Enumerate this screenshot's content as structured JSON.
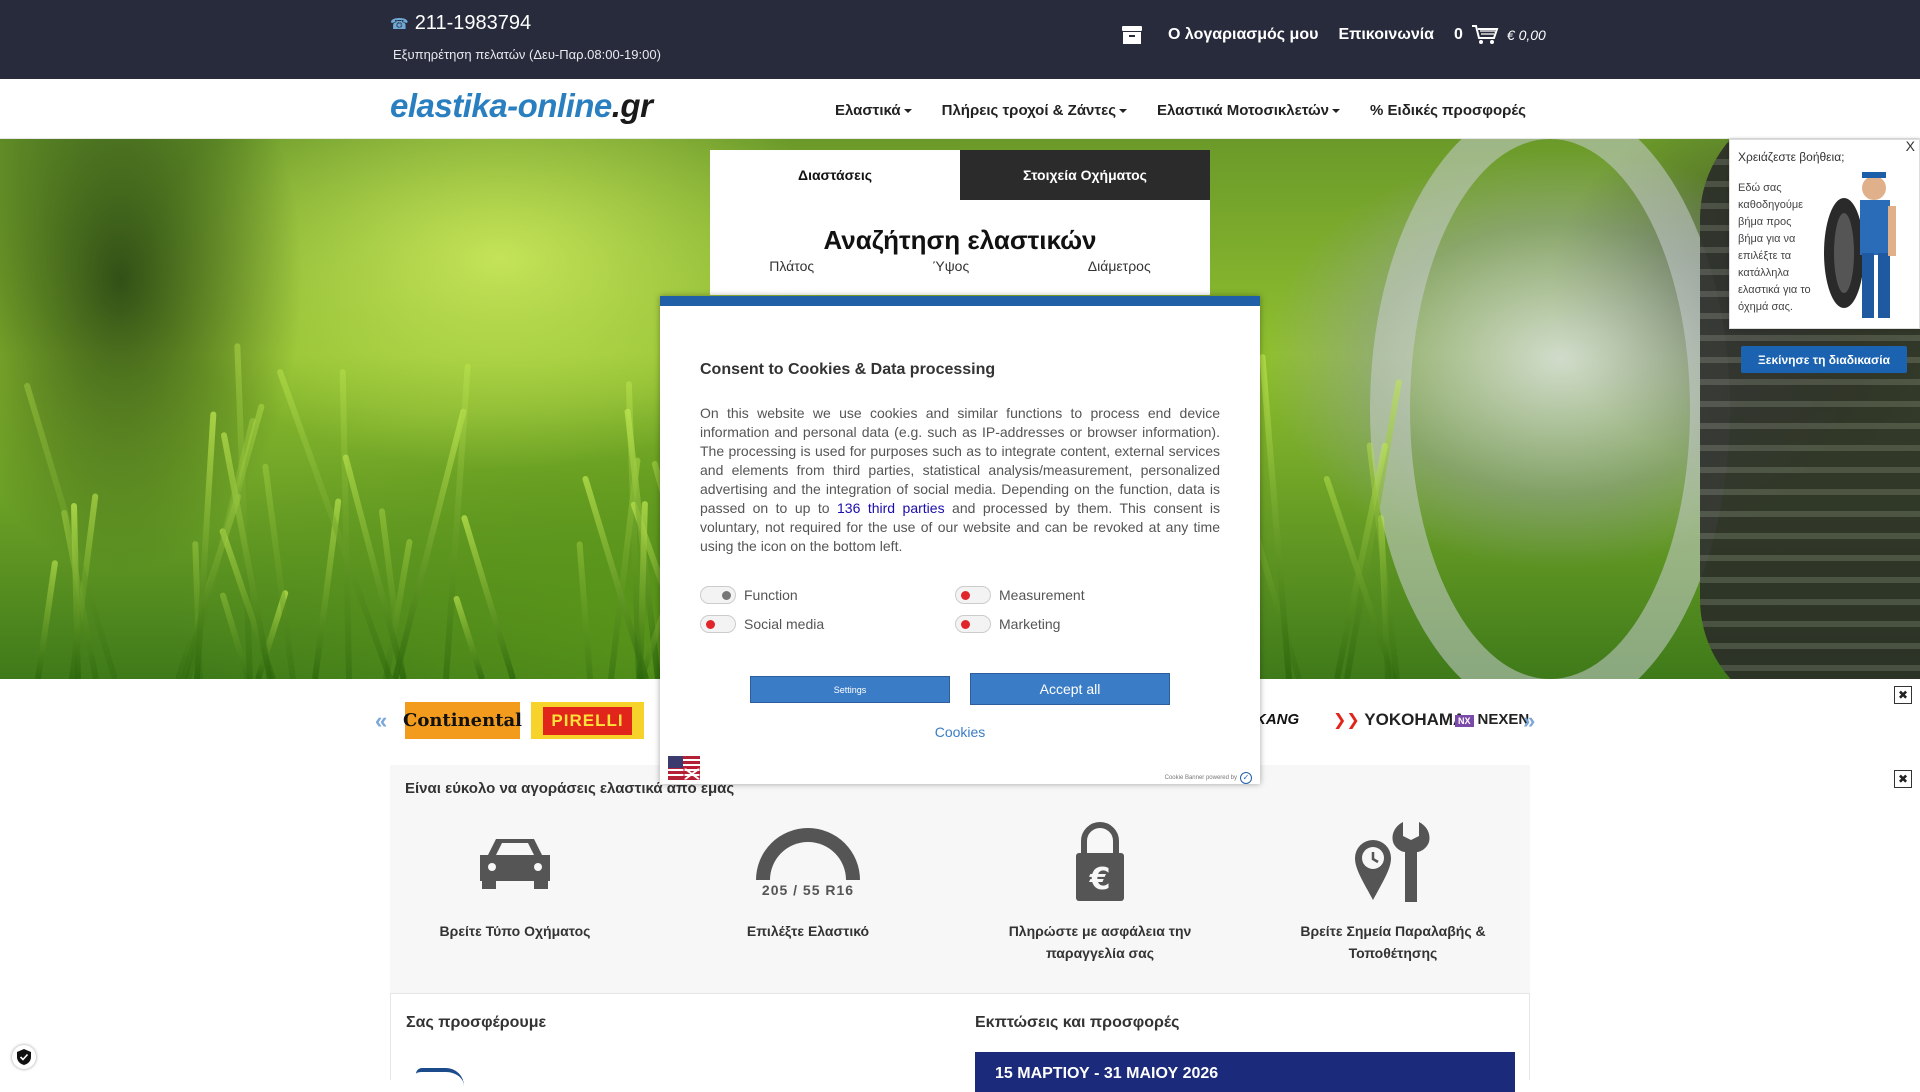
{
  "header": {
    "phone": "211-1983794",
    "hours": "Εξυπηρέτηση πελατών (Δευ-Παρ.08:00-19:00)",
    "account": "Ο λογαριασμός μου",
    "contact": "Επικοινωνία",
    "cart_count": "0",
    "cart_total": "€ 0,00"
  },
  "logo": {
    "part1": "elastika-online",
    "part2": ".gr"
  },
  "menu": [
    {
      "label": "Ελαστικά"
    },
    {
      "label": "Πλήρεις τροχοί & Ζάντες"
    },
    {
      "label": "Ελαστικά Μοτοσικλετών"
    },
    {
      "label": "% Ειδικές προσφορές"
    }
  ],
  "search": {
    "tab_dimensions": "Διαστάσεις",
    "tab_vehicle": "Στοιχεία Οχήματος",
    "title": "Αναζήτηση ελαστικών",
    "width_label": "Πλάτος",
    "height_label": "Ύψος",
    "diameter_label": "Διάμετρος"
  },
  "help": {
    "title": "Χρειάζεστε βοήθεια;",
    "body": "Εδώ σας καθοδηγούμε βήμα προς βήμα για να επιλέξτε τα κατάλληλα ελαστικά για το όχημά σας.",
    "close": "X",
    "button": "Ξεκίνησε τη διαδικασία"
  },
  "brands": {
    "continental": "Continental",
    "pirelli": "PIRELLI",
    "kang": "KANG",
    "yokohama": "YOKOHAMA",
    "nexen": "NEXEN"
  },
  "easy": {
    "title": "Είναι εύκολο να αγοράσεις ελαστικά από εμάς",
    "tire_size": "205 / 55 R16",
    "steps": [
      {
        "label": "Βρείτε Τύπο Οχήματος"
      },
      {
        "label": "Επιλέξτε Ελαστικό"
      },
      {
        "label": "Πληρώστε με ασφάλεια την παραγγελία σας"
      },
      {
        "label": "Βρείτε Σημεία Παραλαβής & Τοποθέτησης"
      }
    ]
  },
  "bottom": {
    "offer_title": "Σας προσφέρουμε",
    "deals_title": "Εκπτώσεις και προσφορές",
    "deals_banner": "15 ΜΑΡΤΙΟΥ - 31 ΜΑΙΟΥ 2026"
  },
  "cookie": {
    "title": "Consent to Cookies & Data processing",
    "body_before": "On this website we use cookies and similar functions to process end device information and personal data (e.g. such as IP-addresses or browser information). The processing is used for purposes such as to integrate content, external services and elements from third parties, statistical analysis/measurement, personalized advertising and the integration of social media. Depending on the function, data is passed on to up to ",
    "body_link": "136 third parties",
    "body_after": " and processed by them. This consent is voluntary, not required for the use of our website and can be revoked at any time using the icon on the bottom left.",
    "toggles": [
      {
        "label": "Function",
        "color": "#777777"
      },
      {
        "label": "Measurement",
        "color": "#e0262b"
      },
      {
        "label": "Social media",
        "color": "#e0262b"
      },
      {
        "label": "Marketing",
        "color": "#e0262b"
      }
    ],
    "settings": "Settings",
    "accept": "Accept all",
    "cookies_link": "Cookies",
    "powered": "Cookie Banner powered by"
  },
  "colors": {
    "topbar": "#272b3c",
    "accent": "#1f5fa8",
    "logo_blue": "#2a7fc0"
  }
}
